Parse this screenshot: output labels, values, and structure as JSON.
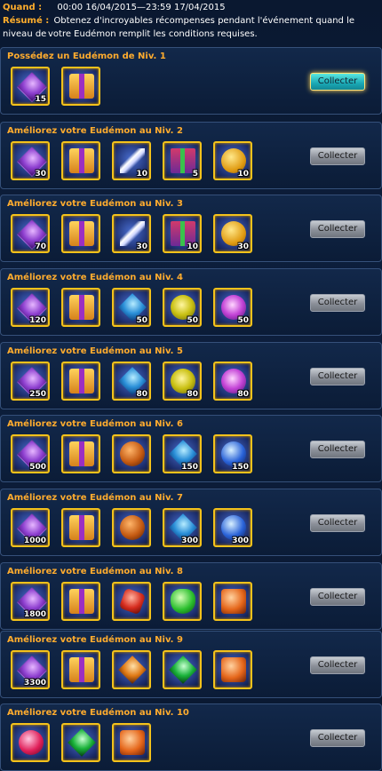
{
  "header": {
    "when_label": "Quand :",
    "when_value": "00:00 16/04/2015—23:59 17/04/2015",
    "summary_label": "Résumé :",
    "summary_line1": "Obtenez d'incroyables récompenses pendant l'événement quand le niveau de",
    "summary_line2": "votre Eudémon remplit les conditions requises."
  },
  "colors": {
    "accent": "#ffae2c",
    "button_active": "#1aa9b5",
    "item_border": "#f4c21b"
  },
  "tiers": [
    {
      "title": "Possédez un Eudémon de Niv. 1",
      "button": "Collecter",
      "button_active": true,
      "items": [
        {
          "icon": "purple-gem-icon",
          "count": "15"
        },
        {
          "icon": "treasure-chest-icon",
          "count": ""
        }
      ]
    },
    {
      "title": "Améliorez votre Eudémon au Niv. 2",
      "button": "Collecter",
      "button_active": false,
      "items": [
        {
          "icon": "purple-gem-icon",
          "count": "30"
        },
        {
          "icon": "treasure-chest-icon",
          "count": ""
        },
        {
          "icon": "feather-icon",
          "count": "10"
        },
        {
          "icon": "gift-box-icon",
          "count": "5"
        },
        {
          "icon": "gold-coin-icon",
          "count": "10"
        }
      ]
    },
    {
      "title": "Améliorez votre Eudémon au Niv. 3",
      "button": "Collecter",
      "button_active": false,
      "items": [
        {
          "icon": "purple-gem-icon",
          "count": "70"
        },
        {
          "icon": "treasure-chest-icon",
          "count": ""
        },
        {
          "icon": "feather-icon",
          "count": "30"
        },
        {
          "icon": "gift-box-icon",
          "count": "10"
        },
        {
          "icon": "gold-coin-icon",
          "count": "30"
        }
      ]
    },
    {
      "title": "Améliorez votre Eudémon au Niv. 4",
      "button": "Collecter",
      "button_active": false,
      "items": [
        {
          "icon": "purple-gem-icon",
          "count": "120"
        },
        {
          "icon": "treasure-chest-icon",
          "count": ""
        },
        {
          "icon": "blue-diamond-icon",
          "count": "50"
        },
        {
          "icon": "yellow-orb-icon",
          "count": "50"
        },
        {
          "icon": "purple-orb-icon",
          "count": "50"
        }
      ]
    },
    {
      "title": "Améliorez votre Eudémon au Niv. 5",
      "button": "Collecter",
      "button_active": false,
      "items": [
        {
          "icon": "purple-gem-icon",
          "count": "250"
        },
        {
          "icon": "treasure-chest-icon",
          "count": ""
        },
        {
          "icon": "blue-diamond-icon",
          "count": "80"
        },
        {
          "icon": "yellow-orb-icon",
          "count": "80"
        },
        {
          "icon": "purple-orb-icon",
          "count": "80"
        }
      ]
    },
    {
      "title": "Améliorez votre Eudémon au Niv. 6",
      "button": "Collecter",
      "button_active": false,
      "items": [
        {
          "icon": "purple-gem-icon",
          "count": "500"
        },
        {
          "icon": "treasure-chest-icon",
          "count": ""
        },
        {
          "icon": "orange-orb-icon",
          "count": ""
        },
        {
          "icon": "blue-diamond-icon",
          "count": "150"
        },
        {
          "icon": "blue-orb-icon",
          "count": "150"
        }
      ]
    },
    {
      "title": "Améliorez votre Eudémon au Niv. 7",
      "button": "Collecter",
      "button_active": false,
      "items": [
        {
          "icon": "purple-gem-icon",
          "count": "1000"
        },
        {
          "icon": "treasure-chest-icon",
          "count": ""
        },
        {
          "icon": "orange-orb-icon",
          "count": ""
        },
        {
          "icon": "blue-diamond-icon",
          "count": "300"
        },
        {
          "icon": "blue-orb-icon",
          "count": "300"
        }
      ]
    },
    {
      "title": "Améliorez votre Eudémon au Niv. 8",
      "button": "Collecter",
      "button_active": false,
      "items": [
        {
          "icon": "purple-gem-icon",
          "count": "1800"
        },
        {
          "icon": "treasure-chest-icon",
          "count": ""
        },
        {
          "icon": "red-crystal-icon",
          "count": ""
        },
        {
          "icon": "green-crystal-icon",
          "count": ""
        },
        {
          "icon": "orange-crystal-icon",
          "count": ""
        }
      ]
    },
    {
      "title": "Améliorez votre Eudémon au Niv. 9",
      "button": "Collecter",
      "button_active": false,
      "items": [
        {
          "icon": "purple-gem-icon",
          "count": "3300"
        },
        {
          "icon": "treasure-chest-icon",
          "count": ""
        },
        {
          "icon": "amber-gem-icon",
          "count": ""
        },
        {
          "icon": "emerald-gem-icon",
          "count": ""
        },
        {
          "icon": "orange-crystal-icon",
          "count": ""
        }
      ]
    },
    {
      "title": "Améliorez votre Eudémon au Niv. 10",
      "button": "Collecter",
      "button_active": false,
      "items": [
        {
          "icon": "ruby-gem-icon",
          "count": ""
        },
        {
          "icon": "emerald-gem-icon",
          "count": ""
        },
        {
          "icon": "orange-crystal-icon",
          "count": ""
        }
      ]
    }
  ]
}
